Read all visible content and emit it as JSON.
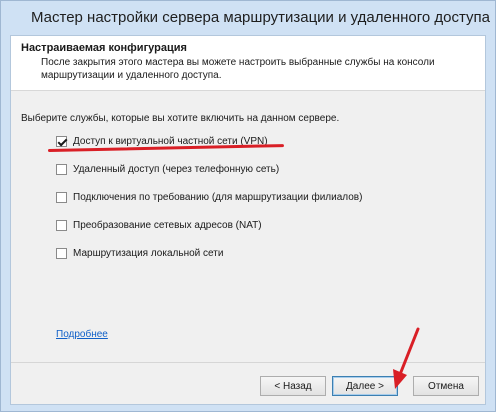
{
  "window": {
    "title": "Мастер настройки сервера маршрутизации и удаленного доступа"
  },
  "header": {
    "title": "Настраиваемая конфигурация",
    "description": "После закрытия этого мастера вы можете настроить выбранные службы на консоли маршрутизации и удаленного доступа."
  },
  "main": {
    "prompt": "Выберите службы, которые вы хотите включить на данном сервере.",
    "options": [
      {
        "label": "Доступ к виртуальной частной сети (VPN)",
        "checked": true
      },
      {
        "label": "Удаленный доступ (через телефонную сеть)",
        "checked": false
      },
      {
        "label": "Подключения по требованию (для маршрутизации филиалов)",
        "checked": false
      },
      {
        "label": "Преобразование сетевых адресов (NAT)",
        "checked": false
      },
      {
        "label": "Маршрутизация локальной сети",
        "checked": false
      }
    ],
    "more_link": "Подробнее"
  },
  "footer": {
    "back_label": "< Назад",
    "next_label": "Далее >",
    "cancel_label": "Отмена"
  },
  "annotation": {
    "color": "#d91f26"
  }
}
